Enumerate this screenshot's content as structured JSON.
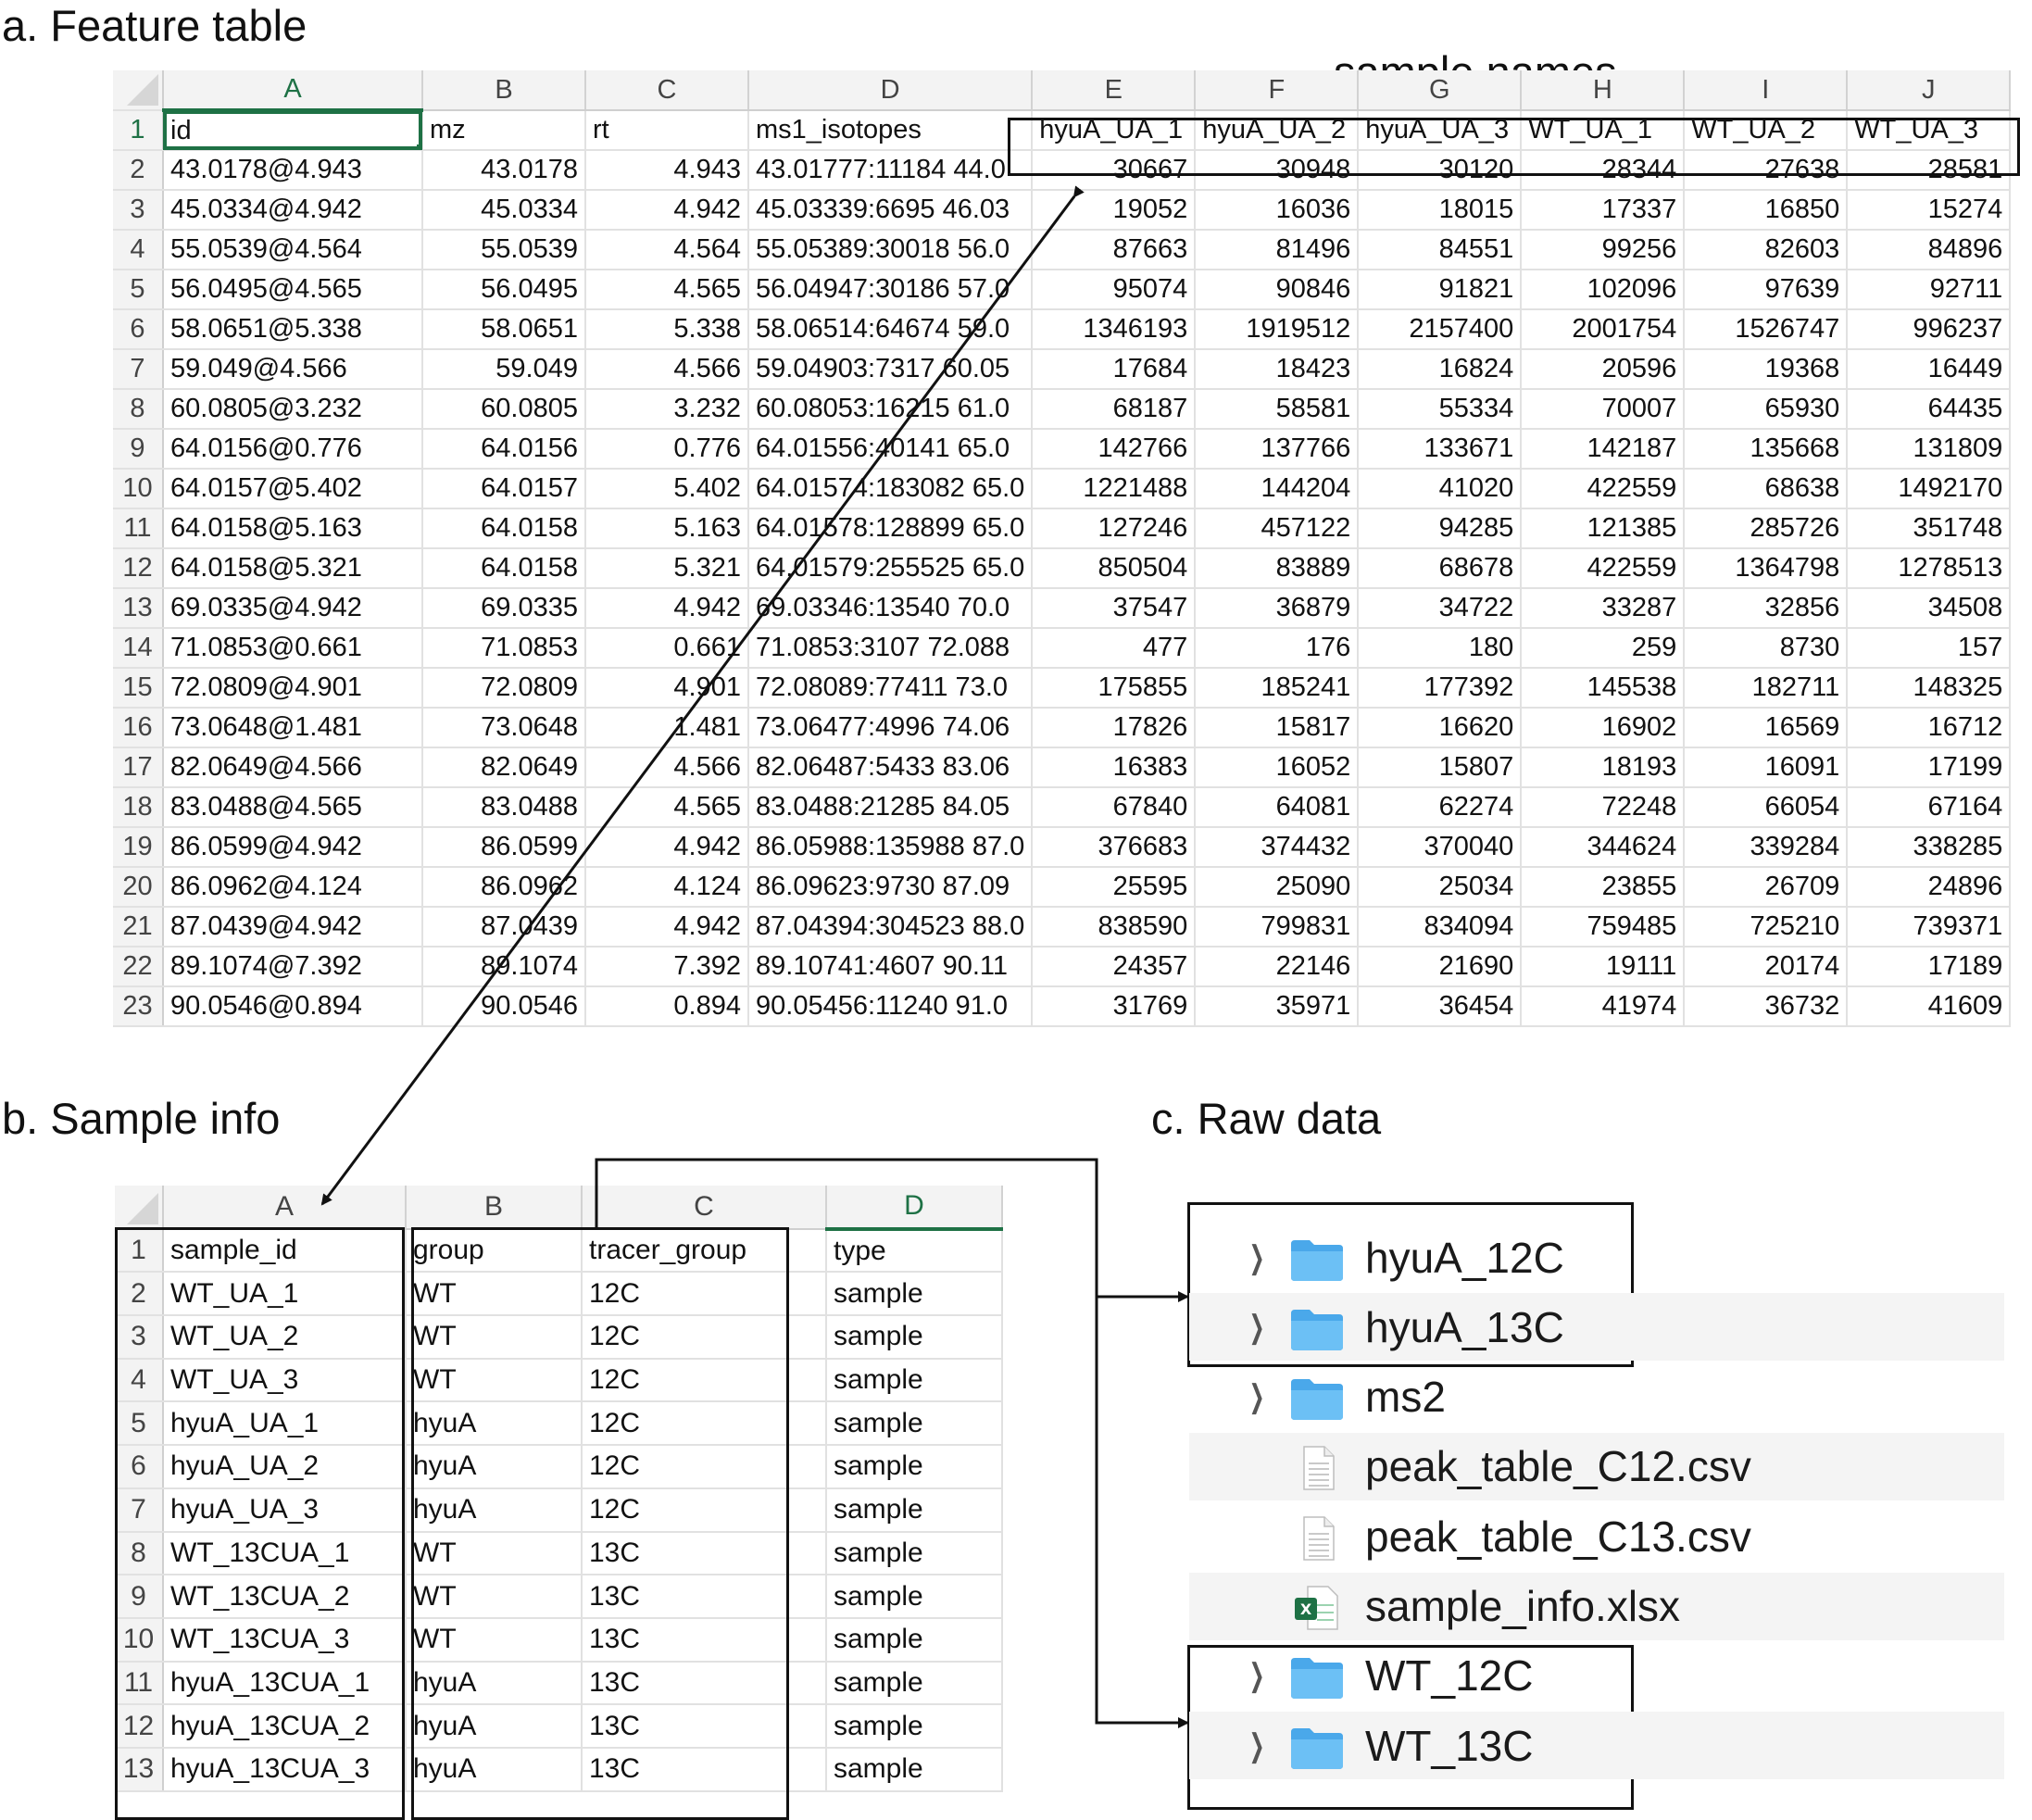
{
  "panels": {
    "a_label": "a. Feature table",
    "b_label": "b. Sample info",
    "c_label": "c. Raw data",
    "sample_names_label": "sample names"
  },
  "feature_table": {
    "col_letters": [
      "A",
      "B",
      "C",
      "D",
      "E",
      "F",
      "G",
      "H",
      "I",
      "J"
    ],
    "selected_col": "A",
    "header_row": [
      "id",
      "mz",
      "rt",
      "ms1_isotopes",
      "hyuA_UA_1",
      "hyuA_UA_2",
      "hyuA_UA_3",
      "WT_UA_1",
      "WT_UA_2",
      "WT_UA_3"
    ],
    "rows": [
      [
        "43.0178@4.943",
        "43.0178",
        "4.943",
        "43.01777:11184 44.0",
        "30667",
        "30948",
        "30120",
        "28344",
        "27638",
        "28581"
      ],
      [
        "45.0334@4.942",
        "45.0334",
        "4.942",
        "45.03339:6695 46.03",
        "19052",
        "16036",
        "18015",
        "17337",
        "16850",
        "15274"
      ],
      [
        "55.0539@4.564",
        "55.0539",
        "4.564",
        "55.05389:30018 56.0",
        "87663",
        "81496",
        "84551",
        "99256",
        "82603",
        "84896"
      ],
      [
        "56.0495@4.565",
        "56.0495",
        "4.565",
        "56.04947:30186 57.0",
        "95074",
        "90846",
        "91821",
        "102096",
        "97639",
        "92711"
      ],
      [
        "58.0651@5.338",
        "58.0651",
        "5.338",
        "58.06514:64674 59.0",
        "1346193",
        "1919512",
        "2157400",
        "2001754",
        "1526747",
        "996237"
      ],
      [
        "59.049@4.566",
        "59.049",
        "4.566",
        "59.04903:7317 60.05",
        "17684",
        "18423",
        "16824",
        "20596",
        "19368",
        "16449"
      ],
      [
        "60.0805@3.232",
        "60.0805",
        "3.232",
        "60.08053:16215 61.0",
        "68187",
        "58581",
        "55334",
        "70007",
        "65930",
        "64435"
      ],
      [
        "64.0156@0.776",
        "64.0156",
        "0.776",
        "64.01556:40141 65.0",
        "142766",
        "137766",
        "133671",
        "142187",
        "135668",
        "131809"
      ],
      [
        "64.0157@5.402",
        "64.0157",
        "5.402",
        "64.01574:183082 65.0",
        "1221488",
        "144204",
        "41020",
        "422559",
        "68638",
        "1492170"
      ],
      [
        "64.0158@5.163",
        "64.0158",
        "5.163",
        "64.01578:128899 65.0",
        "127246",
        "457122",
        "94285",
        "121385",
        "285726",
        "351748"
      ],
      [
        "64.0158@5.321",
        "64.0158",
        "5.321",
        "64.01579:255525 65.0",
        "850504",
        "83889",
        "68678",
        "422559",
        "1364798",
        "1278513"
      ],
      [
        "69.0335@4.942",
        "69.0335",
        "4.942",
        "69.03346:13540 70.0",
        "37547",
        "36879",
        "34722",
        "33287",
        "32856",
        "34508"
      ],
      [
        "71.0853@0.661",
        "71.0853",
        "0.661",
        "71.0853:3107 72.088",
        "477",
        "176",
        "180",
        "259",
        "8730",
        "157"
      ],
      [
        "72.0809@4.901",
        "72.0809",
        "4.901",
        "72.08089:77411 73.0",
        "175855",
        "185241",
        "177392",
        "145538",
        "182711",
        "148325"
      ],
      [
        "73.0648@1.481",
        "73.0648",
        "1.481",
        "73.06477:4996 74.06",
        "17826",
        "15817",
        "16620",
        "16902",
        "16569",
        "16712"
      ],
      [
        "82.0649@4.566",
        "82.0649",
        "4.566",
        "82.06487:5433 83.06",
        "16383",
        "16052",
        "15807",
        "18193",
        "16091",
        "17199"
      ],
      [
        "83.0488@4.565",
        "83.0488",
        "4.565",
        "83.0488:21285 84.05",
        "67840",
        "64081",
        "62274",
        "72248",
        "66054",
        "67164"
      ],
      [
        "86.0599@4.942",
        "86.0599",
        "4.942",
        "86.05988:135988 87.0",
        "376683",
        "374432",
        "370040",
        "344624",
        "339284",
        "338285"
      ],
      [
        "86.0962@4.124",
        "86.0962",
        "4.124",
        "86.09623:9730 87.09",
        "25595",
        "25090",
        "25034",
        "23855",
        "26709",
        "24896"
      ],
      [
        "87.0439@4.942",
        "87.0439",
        "4.942",
        "87.04394:304523 88.0",
        "838590",
        "799831",
        "834094",
        "759485",
        "725210",
        "739371"
      ],
      [
        "89.1074@7.392",
        "89.1074",
        "7.392",
        "89.10741:4607 90.11",
        "24357",
        "22146",
        "21690",
        "19111",
        "20174",
        "17189"
      ],
      [
        "90.0546@0.894",
        "90.0546",
        "0.894",
        "90.05456:11240 91.0",
        "31769",
        "35971",
        "36454",
        "41974",
        "36732",
        "41609"
      ]
    ]
  },
  "sample_info": {
    "col_letters": [
      "A",
      "B",
      "C",
      "D"
    ],
    "selected_col": "D",
    "header_row": [
      "sample_id",
      "group",
      "tracer_group",
      "type"
    ],
    "rows": [
      [
        "WT_UA_1",
        "WT",
        "12C",
        "sample"
      ],
      [
        "WT_UA_2",
        "WT",
        "12C",
        "sample"
      ],
      [
        "WT_UA_3",
        "WT",
        "12C",
        "sample"
      ],
      [
        "hyuA_UA_1",
        "hyuA",
        "12C",
        "sample"
      ],
      [
        "hyuA_UA_2",
        "hyuA",
        "12C",
        "sample"
      ],
      [
        "hyuA_UA_3",
        "hyuA",
        "12C",
        "sample"
      ],
      [
        "WT_13CUA_1",
        "WT",
        "13C",
        "sample"
      ],
      [
        "WT_13CUA_2",
        "WT",
        "13C",
        "sample"
      ],
      [
        "WT_13CUA_3",
        "WT",
        "13C",
        "sample"
      ],
      [
        "hyuA_13CUA_1",
        "hyuA",
        "13C",
        "sample"
      ],
      [
        "hyuA_13CUA_2",
        "hyuA",
        "13C",
        "sample"
      ],
      [
        "hyuA_13CUA_3",
        "hyuA",
        "13C",
        "sample"
      ]
    ]
  },
  "raw_data": {
    "items": [
      {
        "name": "hyuA_12C",
        "kind": "folder",
        "expandable": true,
        "icon": "folder-icon"
      },
      {
        "name": "hyuA_13C",
        "kind": "folder",
        "expandable": true,
        "icon": "folder-icon"
      },
      {
        "name": "ms2",
        "kind": "folder",
        "expandable": true,
        "icon": "folder-icon"
      },
      {
        "name": "peak_table_C12.csv",
        "kind": "csv",
        "expandable": false,
        "icon": "csv-file-icon"
      },
      {
        "name": "peak_table_C13.csv",
        "kind": "csv",
        "expandable": false,
        "icon": "csv-file-icon"
      },
      {
        "name": "sample_info.xlsx",
        "kind": "xlsx",
        "expandable": false,
        "icon": "excel-file-icon"
      },
      {
        "name": "WT_12C",
        "kind": "folder",
        "expandable": true,
        "icon": "folder-icon"
      },
      {
        "name": "WT_13C",
        "kind": "folder",
        "expandable": true,
        "icon": "folder-icon"
      }
    ]
  },
  "colors": {
    "excel_green": "#1e7145",
    "folder_blue": "#5ab4f0",
    "finder_stripe": "#f4f4f4"
  }
}
